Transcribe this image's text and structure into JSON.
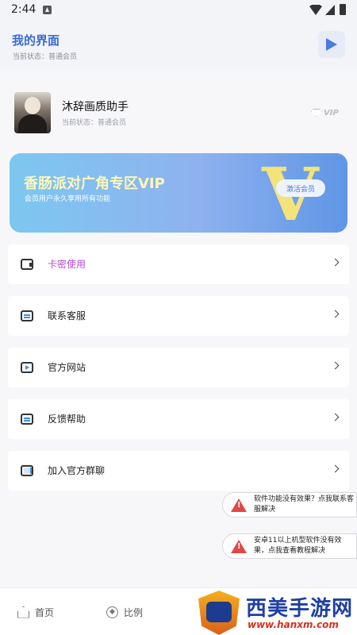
{
  "status_bar": {
    "time": "2:44"
  },
  "header": {
    "title": "我的界面",
    "subtitle": "当前状态：普通会员"
  },
  "profile": {
    "name": "沐辞画质助手",
    "status": "当前状态：普通会员",
    "badge": "VIP"
  },
  "banner": {
    "title": "香肠派对广角专区VIP",
    "subtitle": "会员用户永久享用所有功能",
    "big_letter": "V",
    "button": "激活会员"
  },
  "menu": [
    {
      "label": "卡密使用",
      "icon": "card-icon"
    },
    {
      "label": "联系客服",
      "icon": "chat-icon"
    },
    {
      "label": "官方网站",
      "icon": "play-icon"
    },
    {
      "label": "反馈帮助",
      "icon": "chat-icon"
    },
    {
      "label": "加入官方群聊",
      "icon": "book-icon"
    }
  ],
  "toasts": [
    {
      "text": "软件功能没有效果？点我联系客服解决"
    },
    {
      "text": "安卓11以上机型软件没有效果，点我查看教程解决"
    }
  ],
  "tabbar": [
    {
      "label": "首页",
      "icon": "home-icon"
    },
    {
      "label": "比例",
      "icon": "compass-icon"
    }
  ],
  "watermark": {
    "brand": "西美手游网",
    "site": "www.hanxm.com"
  },
  "colors": {
    "accent": "#3a6ad8",
    "card_label": "#b54ad7",
    "warning": "#e04848"
  }
}
